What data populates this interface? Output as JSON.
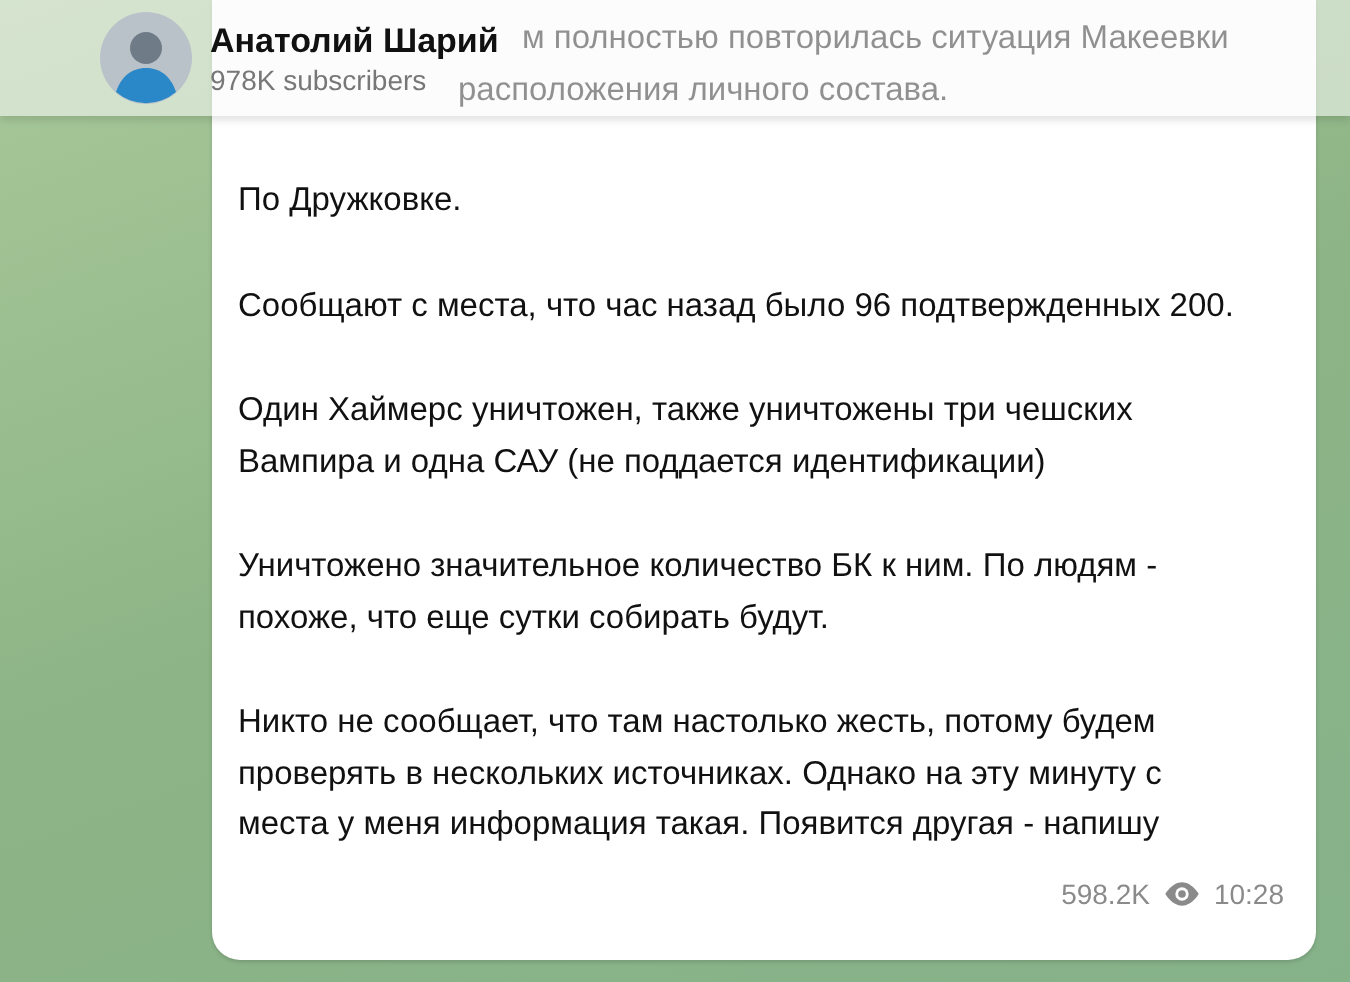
{
  "channel": {
    "name": "Анатолий Шарий",
    "subscribers": "978K subscribers"
  },
  "message": {
    "hidden_lines": [
      "м полностью повторилась ситуация Макеевки",
      "расположения личного состава."
    ],
    "paragraphs": [
      "По Дружковке.",
      "Сообщают с места, что час назад было 96 подтвержденных 200.",
      "Один Хаймерс уничтожен, также уничтожены три чешских Вампира и одна САУ (не поддается идентификации)",
      "Уничтожено значительное количество БК к ним. По людям - похоже, что еще сутки собирать будут.",
      "Никто не сообщает, что там настолько жесть, потому будем проверять в нескольких источниках. Однако на эту минуту с места у меня информация такая. Появится другая - напишу"
    ],
    "views": "598.2K",
    "time": "10:28"
  }
}
